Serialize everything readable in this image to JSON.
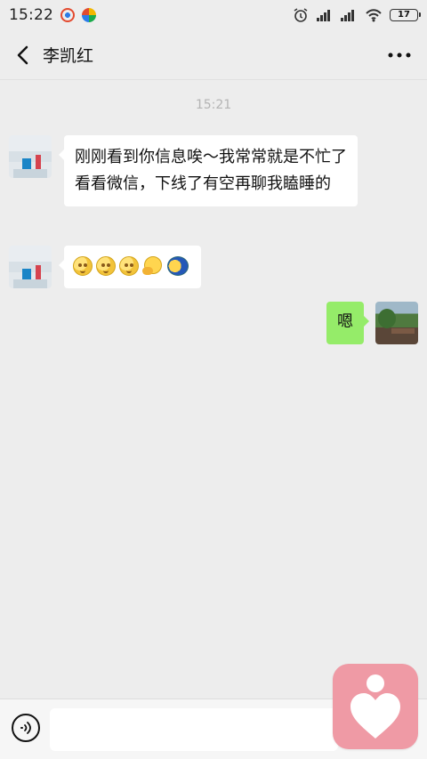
{
  "status_bar": {
    "time": "15:22",
    "battery": "17",
    "icons": [
      "app-icon-1",
      "app-icon-2",
      "alarm-icon",
      "signal-icon",
      "wifi-icon",
      "battery-icon"
    ]
  },
  "header": {
    "title": "李凯红",
    "back_icon": "chevron-left-icon",
    "more_icon": "more-icon"
  },
  "messages": {
    "timestamp": "15:21",
    "items": [
      {
        "side": "left",
        "text": "刚刚看到你信息唉～我常常就是不忙了看看微信，下线了有空再聊我瞌睡的"
      },
      {
        "side": "left",
        "emojis": [
          "smile-emoji",
          "smile-emoji",
          "smile-emoji",
          "hug-emoji",
          "moon-emoji"
        ]
      },
      {
        "side": "right",
        "text": "嗯"
      }
    ]
  },
  "input": {
    "placeholder": "",
    "voice_icon": "voice-icon"
  },
  "floating_button": {
    "icon": "heart-icon",
    "color": "#ef9aa5"
  }
}
